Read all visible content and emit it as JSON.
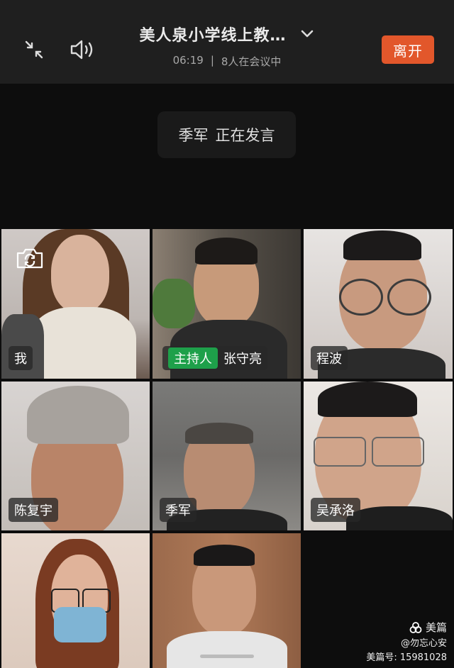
{
  "header": {
    "title": "美人泉小学线上教…",
    "time": "06:19",
    "separator": "|",
    "participants": "8人在会议中",
    "leave_label": "离开"
  },
  "speaking": {
    "name": "季军",
    "status": "正在发言"
  },
  "tiles": [
    {
      "name": "我"
    },
    {
      "host_badge": "主持人",
      "name": "张守亮"
    },
    {
      "name": "程波"
    },
    {
      "name": "陈复宇"
    },
    {
      "name": "季军"
    },
    {
      "name": "吴承洛"
    },
    {
      "name": ""
    },
    {
      "name": ""
    }
  ],
  "watermark": {
    "brand": "美篇",
    "user": "@勿忘心安",
    "number": "美篇号: 15981028"
  },
  "colors": {
    "leave": "#e2572b",
    "host": "#1ea04a",
    "active_border": "#2f9e4a"
  }
}
